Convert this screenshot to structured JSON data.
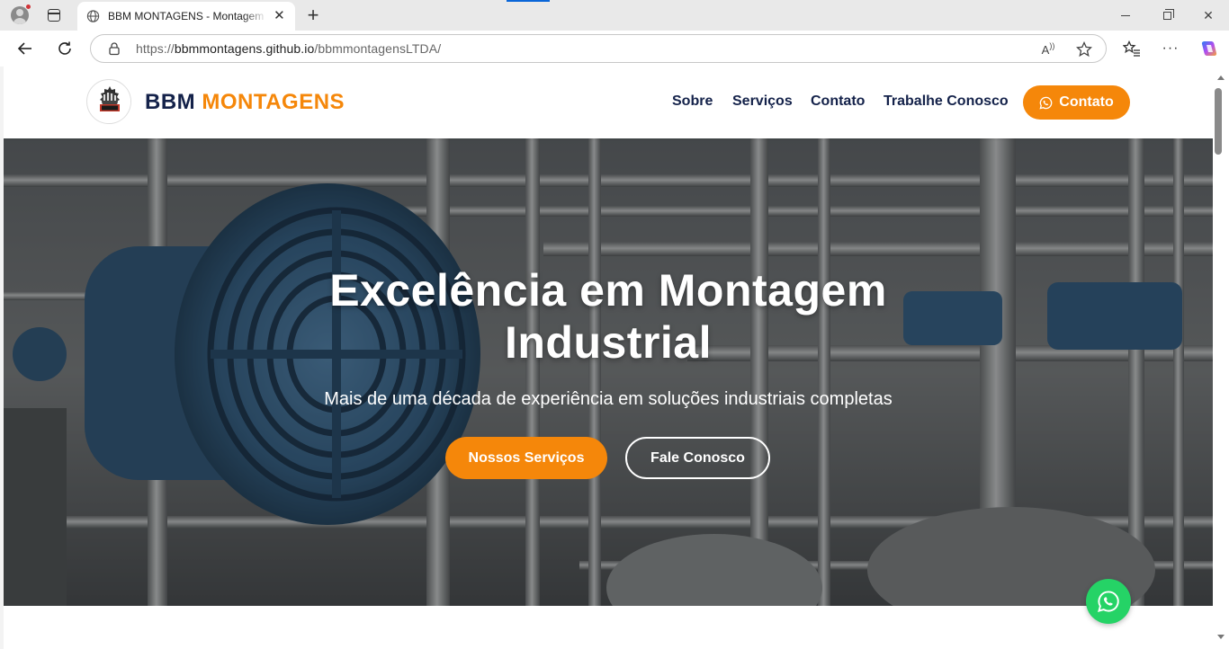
{
  "browser": {
    "tab_title": "BBM MONTAGENS - Montagem Industrial",
    "url_proto": "https://",
    "url_host": "bbmmontagens.github.io",
    "url_path": "/bbmmontagensLTDA/",
    "icons": {
      "profile": "profile-icon",
      "tabs": "tab-actions-icon",
      "globe": "globe-icon",
      "back": "back-arrow-icon",
      "reload": "reload-icon",
      "lock": "lock-icon",
      "read_aloud": "read-aloud-icon",
      "favorite": "star-icon",
      "favorites": "favorites-icon",
      "more": "more-icon",
      "copilot": "copilot-icon"
    }
  },
  "header": {
    "brand_part1": "BBM",
    "brand_part2": "MONTAGENS",
    "nav": {
      "sobre": "Sobre",
      "servicos": "Serviços",
      "contato": "Contato",
      "trabalhe": "Trabalhe Conosco"
    },
    "cta_label": "Contato"
  },
  "hero": {
    "title_line1": "Excelência em Montagem",
    "title_line2": "Industrial",
    "subtitle": "Mais de uma década de experiência em soluções industriais completas",
    "primary_button": "Nossos Serviços",
    "secondary_button": "Fale Conosco"
  },
  "colors": {
    "brand_navy": "#14224a",
    "brand_orange": "#f5870a",
    "whatsapp_green": "#25d366"
  }
}
